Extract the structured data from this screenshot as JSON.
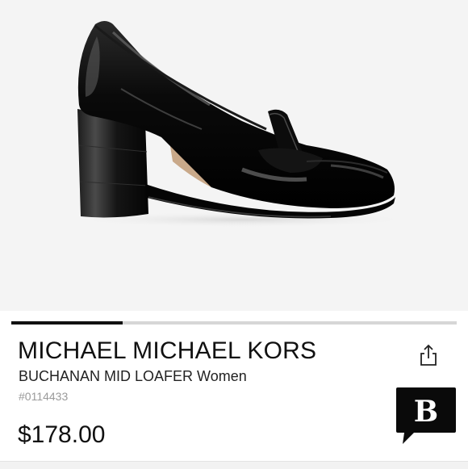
{
  "product": {
    "brand": "MICHAEL MICHAEL KORS",
    "name": "BUCHANAN MID LOAFER Women",
    "sku": "#0114433",
    "price": "$178.00"
  },
  "image_carousel": {
    "progress": 0.25
  },
  "icons": {
    "share": "share-icon",
    "brand_badge": "speech-bubble-b-icon",
    "brand_badge_letter": "B"
  },
  "colors": {
    "text": "#111111",
    "sku": "#9a9a9a",
    "hero_background": "#f4f4f4"
  }
}
